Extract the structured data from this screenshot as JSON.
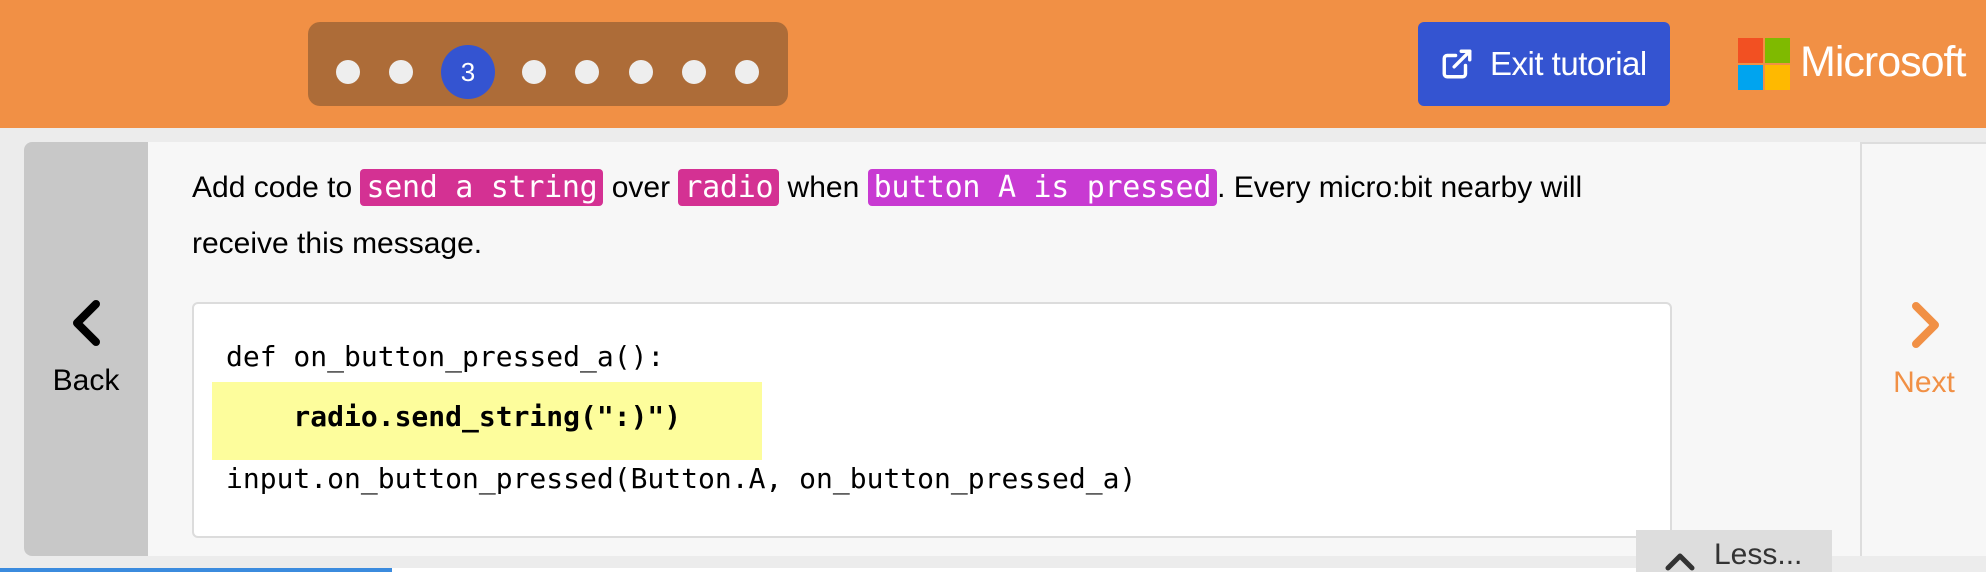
{
  "header": {
    "current_step": "3",
    "total_steps": 8,
    "exit_label": "Exit tutorial",
    "brand": "Microsoft",
    "colors": {
      "topbar": "#f19045",
      "stepper": "#ad6c38",
      "accent_blue": "#3454d1"
    }
  },
  "nav": {
    "back_label": "Back",
    "next_label": "Next",
    "back_icon": "chevron-left-icon",
    "next_icon": "chevron-right-icon"
  },
  "instruction": {
    "part1": "Add code to ",
    "tag1": "send a string",
    "part2": " over ",
    "tag2": "radio",
    "part3": " when ",
    "tag3": "button A is pressed",
    "part4": ". Every micro:bit nearby will receive this message.",
    "tag_colors": {
      "tag1": "#d43193",
      "tag2": "#d43193",
      "tag3": "#c83ad2"
    }
  },
  "code": {
    "line1": "def on_button_pressed_a():",
    "line2": "    radio.send_string(\":)\")",
    "line3": "input.on_button_pressed(Button.A, on_button_pressed_a)",
    "highlight_color": "#fdfd9c"
  },
  "less_label": "Less..."
}
